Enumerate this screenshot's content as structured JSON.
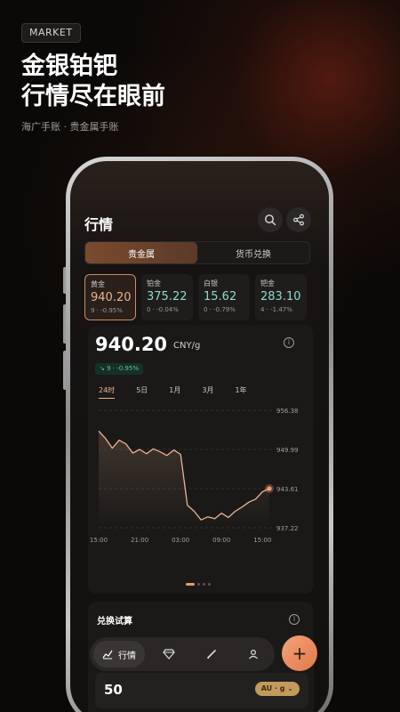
{
  "hero": {
    "tag": "MARKET",
    "headline_line1": "金银铂钯",
    "headline_line2": "行情尽在眼前",
    "subline": "海广手账 · 贵金属手账"
  },
  "app": {
    "title": "行情",
    "segments": [
      {
        "label": "贵金属",
        "active": true
      },
      {
        "label": "货币兑换",
        "active": false
      }
    ],
    "metals": [
      {
        "name": "黄金",
        "price": "940.20",
        "change": "9 · -0.95%",
        "active": true
      },
      {
        "name": "铂金",
        "price": "375.22",
        "change": "0 · -0.04%",
        "active": false
      },
      {
        "name": "白银",
        "price": "15.62",
        "change": "0 · -0.79%",
        "active": false
      },
      {
        "name": "钯金",
        "price": "283.10",
        "change": "4 · -1.47%",
        "active": false
      }
    ],
    "detail": {
      "price": "940.20",
      "unit": "CNY/g",
      "delta": "↘ 9 · -0.95%",
      "range_tabs": [
        "24时",
        "5日",
        "1月",
        "3月",
        "1年"
      ],
      "active_range": "24时"
    },
    "converter": {
      "title": "兑换试算",
      "amount": "50",
      "unit": "AU · g ⌄"
    },
    "nav": {
      "active_label": "行情"
    },
    "fab_label": "+"
  },
  "chart_data": {
    "type": "line",
    "x": [
      "15:00",
      "16:00",
      "17:00",
      "18:00",
      "19:00",
      "20:00",
      "21:00",
      "22:00",
      "23:00",
      "00:00",
      "01:00",
      "02:00",
      "03:00",
      "03:30",
      "04:00",
      "05:00",
      "06:00",
      "07:00",
      "08:00",
      "09:00",
      "10:00",
      "11:00",
      "12:00",
      "13:00",
      "14:00",
      "15:00"
    ],
    "values": [
      953.0,
      951.8,
      950.2,
      951.5,
      950.9,
      949.4,
      950.0,
      949.3,
      950.1,
      949.6,
      949.0,
      949.9,
      949.2,
      940.9,
      939.9,
      938.5,
      939.0,
      938.7,
      939.6,
      938.9,
      939.9,
      940.6,
      941.4,
      941.9,
      943.1,
      943.61
    ],
    "x_tick_labels": [
      "15:00",
      "21:00",
      "03:00",
      "09:00",
      "15:00"
    ],
    "y_tick_labels": [
      "956.38",
      "949.99",
      "943.61",
      "937.22"
    ],
    "ylim": [
      937.22,
      956.38
    ],
    "last_value": 943.61,
    "colors": {
      "line": "#eab48f",
      "area": "#eab48f",
      "marker": "#f39c6b"
    },
    "grid": "horizontal dashed"
  }
}
